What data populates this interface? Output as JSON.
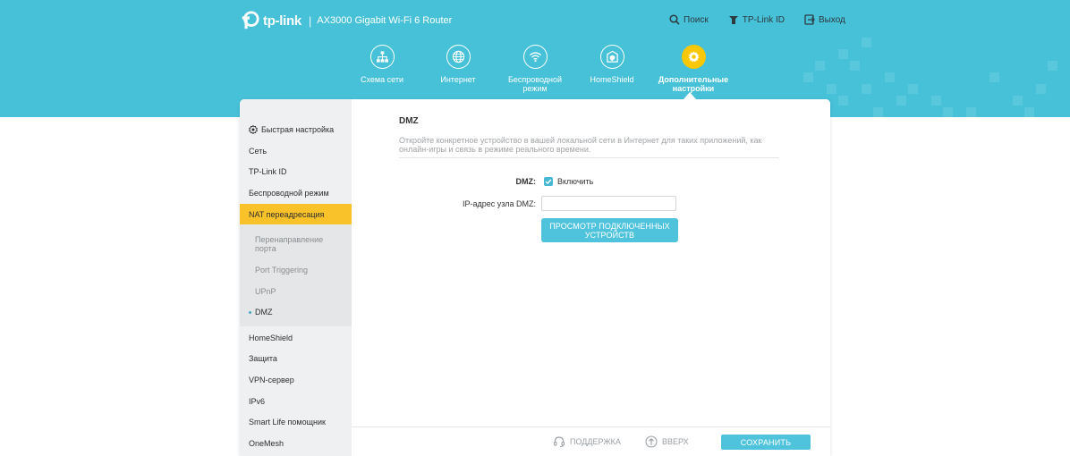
{
  "header": {
    "brand_name": "tp-link",
    "separator": "|",
    "model": "AX3000 Gigabit Wi-Fi 6 Router",
    "links": {
      "search": "Поиск",
      "tplink_id": "TP-Link ID",
      "logout": "Выход"
    },
    "nav": [
      {
        "label": "Схема сети",
        "icon": "network-map-icon"
      },
      {
        "label": "Интернет",
        "icon": "globe-icon"
      },
      {
        "label": "Беспроводной режим",
        "icon": "wifi-icon"
      },
      {
        "label": "HomeShield",
        "icon": "home-shield-icon"
      },
      {
        "label": "Дополнительные настройки",
        "icon": "gear-icon",
        "active": true
      }
    ]
  },
  "sidebar": {
    "items": [
      {
        "label": "Быстрая настройка",
        "icon": "quick-setup-icon"
      },
      {
        "label": "Сеть"
      },
      {
        "label": "TP-Link ID"
      },
      {
        "label": "Беспроводной режим"
      },
      {
        "label": "NAT переадресация",
        "active": true
      },
      {
        "label": "HomeShield"
      },
      {
        "label": "Защита"
      },
      {
        "label": "VPN-сервер"
      },
      {
        "label": "IPv6"
      },
      {
        "label": "Smart Life помощник"
      },
      {
        "label": "OneMesh"
      }
    ],
    "submenu": [
      {
        "label": "Перенаправление порта"
      },
      {
        "label": "Port Triggering"
      },
      {
        "label": "UPnP"
      },
      {
        "label": "DMZ",
        "current": true
      }
    ]
  },
  "content": {
    "title": "DMZ",
    "description": "Откройте конкретное устройство в вашей локальной сети в Интернет для таких приложений, как онлайн-игры и связь в режиме реального времени.",
    "dmz_label": "DMZ:",
    "enable_label": "Включить",
    "enabled": true,
    "ip_label": "IP-адрес узла DMZ:",
    "ip_value": "",
    "view_button": "ПРОСМОТР ПОДКЛЮЧЕННЫХ УСТРОЙСТВ"
  },
  "footer": {
    "support": "ПОДДЕРЖКА",
    "top": "ВВЕРХ",
    "save": "СОХРАНИТЬ"
  },
  "colors": {
    "header_bg": "#47c1d8",
    "accent": "#4fc3dc",
    "active_yellow": "#f9c22a",
    "sidebar_bg": "#eef0f1"
  }
}
